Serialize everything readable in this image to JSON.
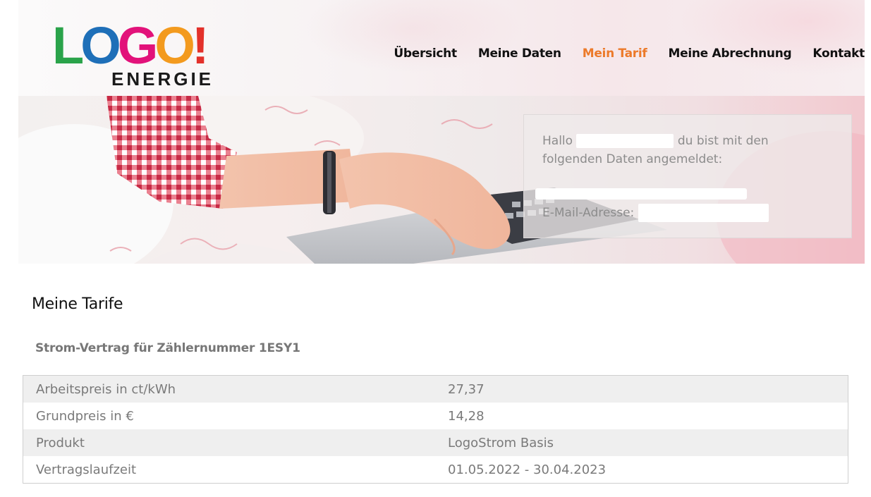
{
  "brand": {
    "logo_letters": [
      {
        "char": "L",
        "color": "#2aa34a"
      },
      {
        "char": "O",
        "color": "#1e6fb8"
      },
      {
        "char": "G",
        "color": "#e2127a"
      },
      {
        "char": "O",
        "color": "#f39a1e"
      },
      {
        "char": "!",
        "color": "#e3312a"
      }
    ],
    "logo_sub": "ENERGIE"
  },
  "nav": {
    "items": [
      {
        "label": "Übersicht",
        "active": false
      },
      {
        "label": "Meine Daten",
        "active": false
      },
      {
        "label": "Mein Tarif",
        "active": true
      },
      {
        "label": "Meine Abrechnung",
        "active": false
      },
      {
        "label": "Kontakt",
        "active": false
      }
    ],
    "active_color": "#ec7a2a"
  },
  "account_box": {
    "greeting_prefix": "Hallo",
    "greeting_suffix": "du bist mit den",
    "greeting_line2": "folgenden Daten angemeldet:",
    "email_label": "E-Mail-Adresse:"
  },
  "main": {
    "title": "Meine Tarife",
    "contract_title": "Strom-Vertrag für Zählernummer 1ESY1",
    "rows": [
      {
        "label": "Arbeitspreis in ct/kWh",
        "value": "27,37"
      },
      {
        "label": "Grundpreis in €",
        "value": "14,28"
      },
      {
        "label": "Produkt",
        "value": "LogoStrom Basis"
      },
      {
        "label": "Vertragslaufzeit",
        "value": "01.05.2022 - 30.04.2023"
      }
    ]
  }
}
